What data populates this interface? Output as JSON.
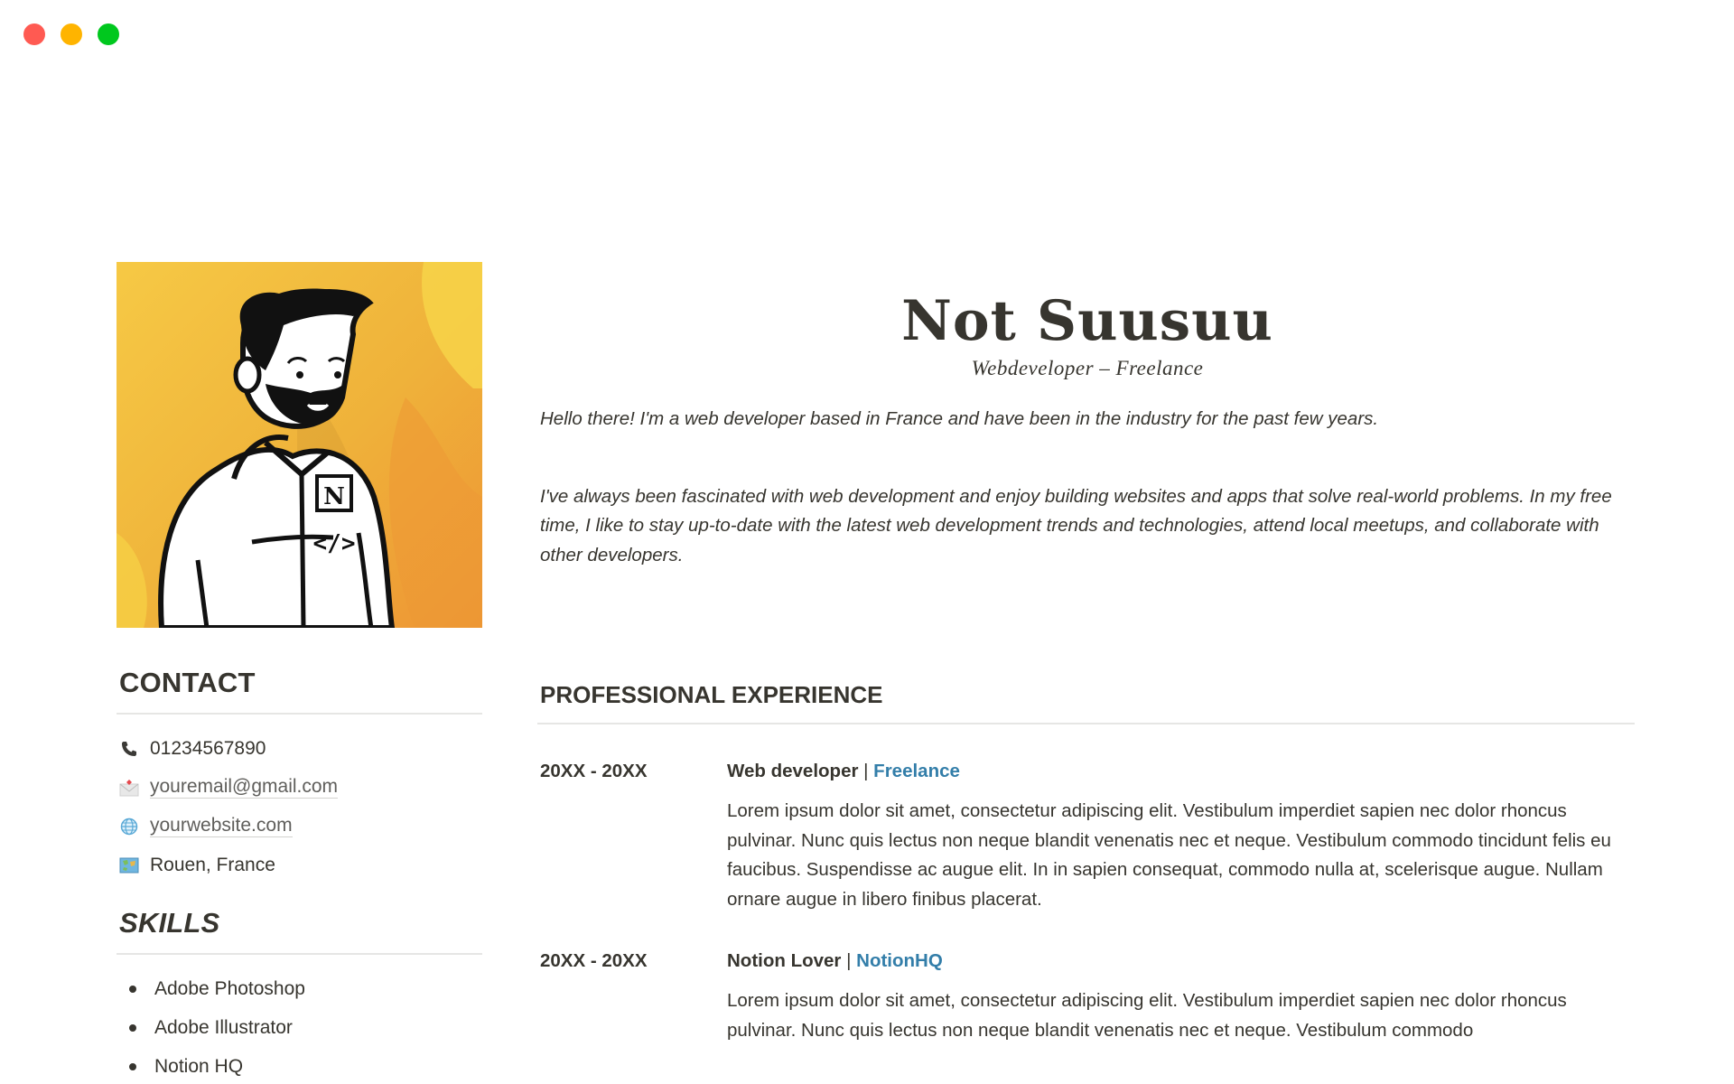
{
  "window": {
    "controls": [
      {
        "name": "close",
        "color": "#ff5a52"
      },
      {
        "name": "minimize",
        "color": "#ffb400"
      },
      {
        "name": "maximize",
        "color": "#00c81e"
      }
    ]
  },
  "profile": {
    "avatar_icon": "illustrated-avatar-bearded-man-hoodie",
    "name": "Not Suusuu",
    "subtitle": "Webdeveloper – Freelance",
    "intro": [
      "Hello there! I'm a web developer based in France and have been in the industry for the past few years.",
      "I've always been fascinated with web development and enjoy building websites and apps that solve real-world problems. In my free time, I like to stay up-to-date with the latest web development trends and technologies, attend local meetups, and collaborate with other developers."
    ]
  },
  "contact": {
    "heading": "CONTACT",
    "items": [
      {
        "icon": "phone-icon",
        "text": "01234567890",
        "link": false
      },
      {
        "icon": "envelope-icon",
        "text": "youremail@gmail.com",
        "link": true
      },
      {
        "icon": "globe-icon",
        "text": "yourwebsite.com",
        "link": true
      },
      {
        "icon": "map-icon",
        "text": "Rouen, France",
        "link": false
      }
    ]
  },
  "skills": {
    "heading": "SKILLS",
    "items": [
      "Adobe Photoshop",
      "Adobe Illustrator",
      "Notion HQ"
    ]
  },
  "experience": {
    "heading": "PROFESSIONAL EXPERIENCE",
    "link_color": "#337ea9",
    "jobs": [
      {
        "dates": "20XX - 20XX",
        "role": "Web developer",
        "separator": " | ",
        "company": "Freelance",
        "description": "Lorem ipsum dolor sit amet, consectetur adipiscing elit. Vestibulum imperdiet sapien nec dolor rhoncus pulvinar. Nunc quis lectus non neque blandit venenatis nec et neque. Vestibulum commodo tincidunt felis eu faucibus. Suspendisse ac augue elit. In in sapien consequat, commodo nulla at, scelerisque augue. Nullam ornare augue in libero finibus placerat."
      },
      {
        "dates": "20XX - 20XX",
        "role": "Notion Lover",
        "separator": " | ",
        "company": "NotionHQ",
        "description": "Lorem ipsum dolor sit amet, consectetur adipiscing elit. Vestibulum imperdiet sapien nec dolor rhoncus pulvinar. Nunc quis lectus non neque blandit venenatis nec et neque. Vestibulum commodo"
      }
    ]
  }
}
